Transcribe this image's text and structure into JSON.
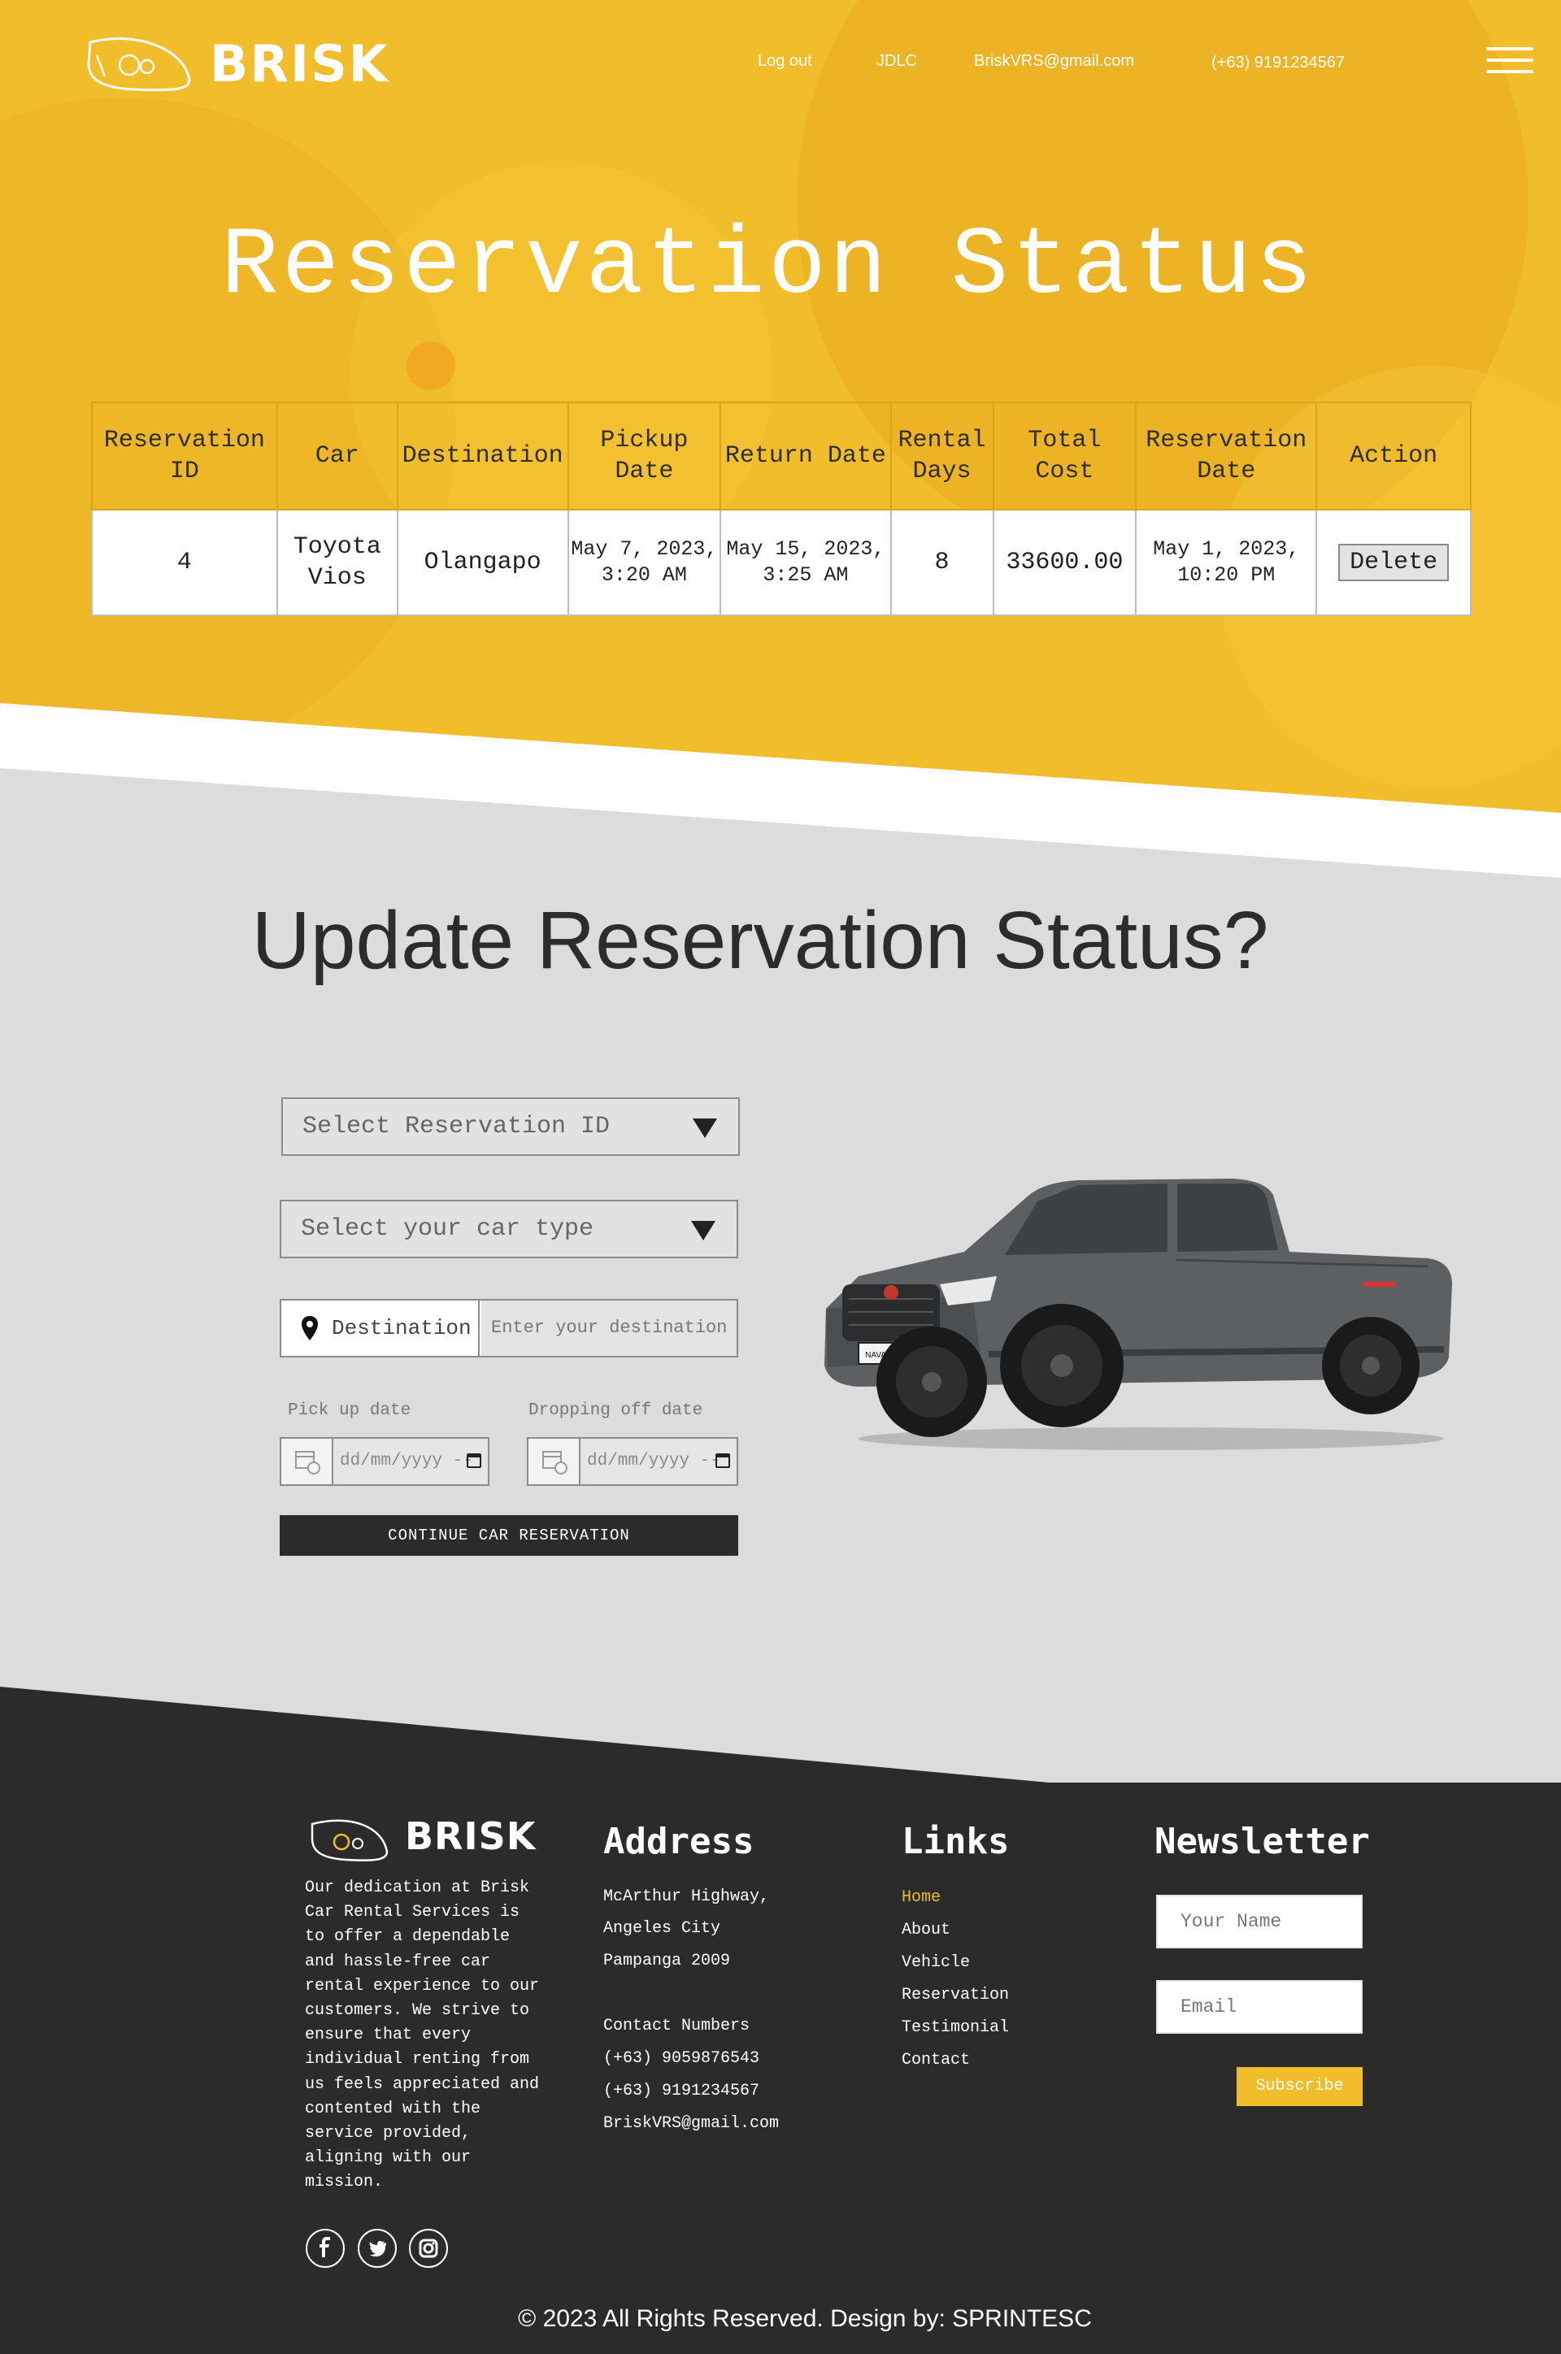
{
  "brand": {
    "name": "BRISK",
    "accent": "#f2bd2b",
    "dark": "#2b2b2b"
  },
  "nav": {
    "links": [
      "Log out",
      "JDLC",
      "BriskVRS@gmail.com",
      "(+63) 9191234567"
    ],
    "menu_icon": "hamburger-icon"
  },
  "hero": {
    "title": "Reservation Status"
  },
  "table": {
    "headers": [
      "Reservation ID",
      "Car",
      "Destination",
      "Pickup Date",
      "Return Date",
      "Rental Days",
      "Total Cost",
      "Reservation Date",
      "Action"
    ],
    "rows": [
      {
        "id": "4",
        "car": "Toyota Vios",
        "destination": "Olangapo",
        "pickup_date": "May 7, 2023, 3:20 AM",
        "return_date": "May 15, 2023, 3:25 AM",
        "rental_days": "8",
        "total_cost": "33600.00",
        "reservation_date": "May 1, 2023, 10:20 PM",
        "action_label": "Delete"
      }
    ]
  },
  "update": {
    "title": "Update Reservation Status?",
    "select_reservation": "Select Reservation ID",
    "select_car": "Select your car type",
    "destination_label": "Destination",
    "destination_placeholder": "Enter your destination",
    "pickup_label": "Pick up date",
    "dropoff_label": "Dropping off date",
    "date_placeholder": "dd/mm/yyyy --",
    "continue_label": "CONTINUE CAR RESERVATION",
    "truck_badge": "NAVARA"
  },
  "footer": {
    "about": "Our dedication at Brisk Car Rental Services is to offer a dependable and hassle-free car rental experience to our customers. We strive to ensure that every individual renting from us feels appreciated and contented with the service provided, aligning with our mission.",
    "address_heading": "Address",
    "address_lines": [
      "McArthur Highway,",
      "Angeles City",
      "Pampanga 2009"
    ],
    "contact_heading": "Contact Numbers",
    "contact_lines": [
      "(+63) 9059876543",
      "(+63) 9191234567",
      "BriskVRS@gmail.com"
    ],
    "links_heading": "Links",
    "links": [
      "Home",
      "About",
      "Vehicle",
      "Reservation",
      "Testimonial",
      "Contact"
    ],
    "newsletter_heading": "Newsletter",
    "name_placeholder": "Your Name",
    "email_placeholder": "Email",
    "subscribe_label": "Subscribe",
    "social_icons": [
      "facebook-icon",
      "twitter-icon",
      "instagram-icon"
    ],
    "copyright": "© 2023 All Rights Reserved. Design by: SPRINTESC"
  }
}
